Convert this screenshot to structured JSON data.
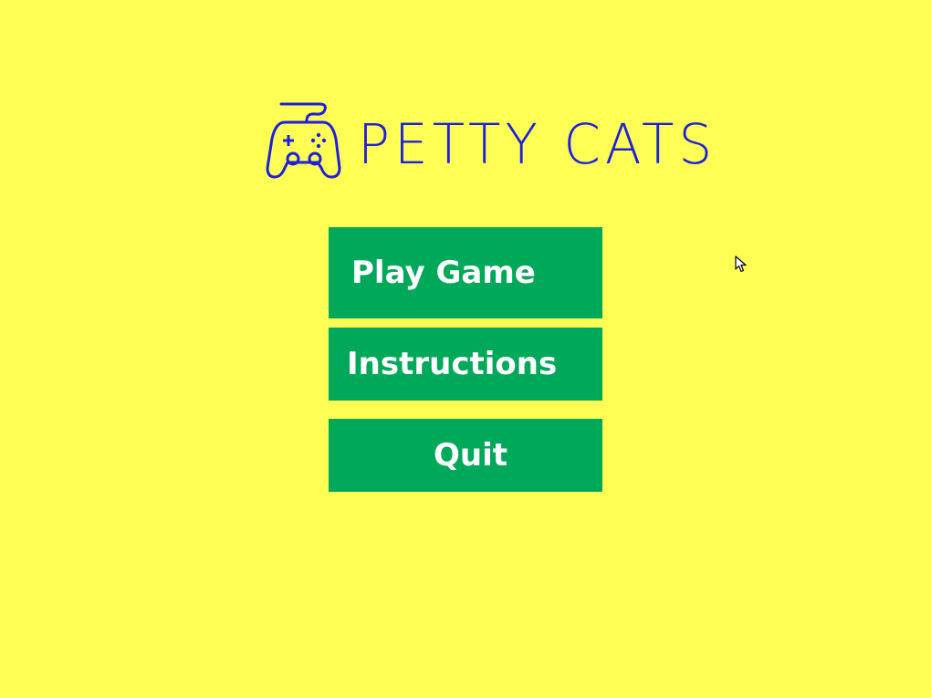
{
  "game": {
    "title": "PETTY CATS",
    "icon": "gamepad-icon"
  },
  "menu": {
    "play_label": "Play Game",
    "instructions_label": "Instructions",
    "quit_label": "Quit"
  },
  "colors": {
    "background": "#fffe55",
    "logo": "#1f1fdb",
    "button": "#00a859",
    "button_text": "#ffffff"
  }
}
